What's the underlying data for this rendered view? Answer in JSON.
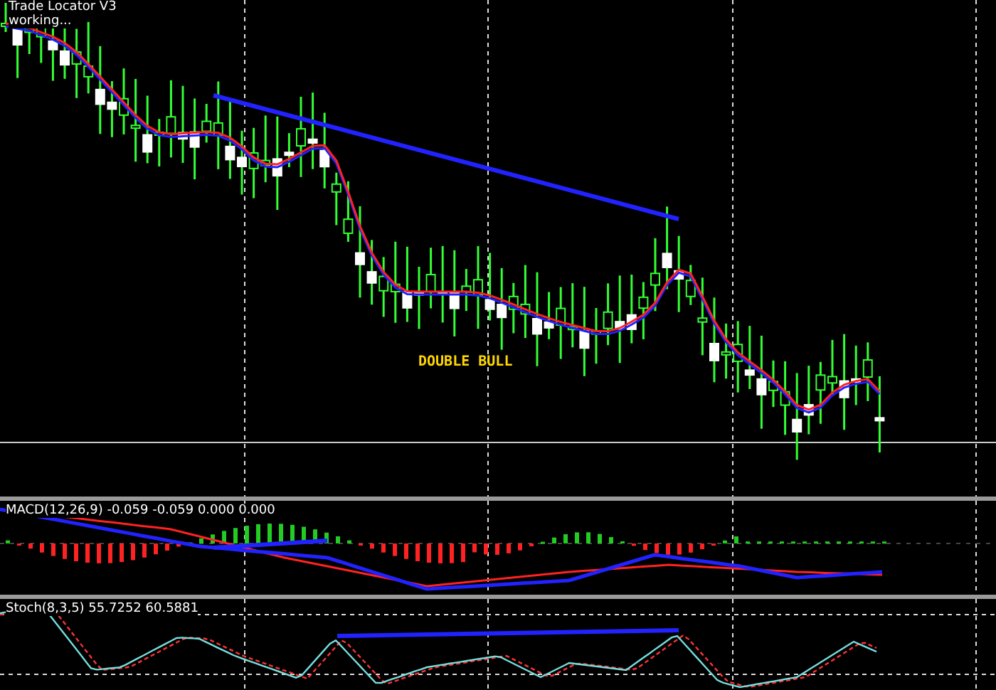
{
  "indicator": {
    "title": "Trade Locator V3",
    "status": "working..."
  },
  "main_chart": {
    "annotation": "DOUBLE BULL"
  },
  "macd_pane": {
    "label": "MACD(12,26,9) -0.059 -0.059 0.000 0.000"
  },
  "stoch_pane": {
    "label": "Stoch(8,3,5) 55.7252 60.5881"
  }
}
